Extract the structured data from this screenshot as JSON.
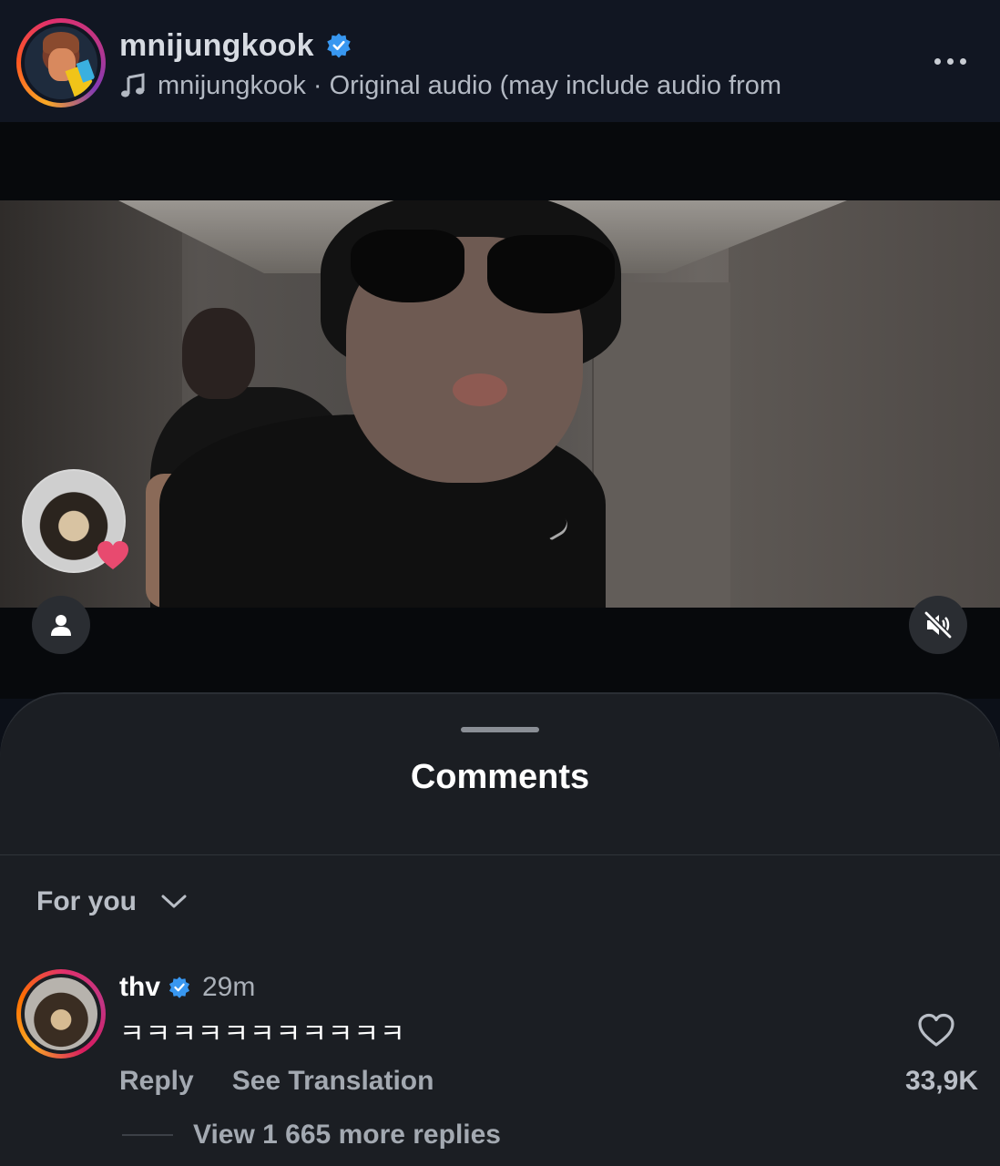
{
  "header": {
    "username": "mnijungkook",
    "audio_text": "mnijungkook · Original audio  (may include audio from",
    "verified_icon": "verified-badge-icon",
    "more_icon": "more-options-icon"
  },
  "video": {
    "tag_icon": "tagged-people-icon",
    "mute_icon": "muted-speaker-icon"
  },
  "comments_sheet": {
    "title": "Comments",
    "filter_label": "For you",
    "comment": {
      "username": "thv",
      "time": "29m",
      "text": "ㅋㅋㅋㅋㅋㅋㅋㅋㅋㅋㅋ",
      "reply_label": "Reply",
      "translate_label": "See Translation",
      "like_count": "33,9K",
      "view_replies": "View 1 665 more replies"
    }
  },
  "colors": {
    "background": "#0c1018",
    "sheet": "#1b1e23",
    "verified": "#3897f0",
    "liker_heart": "#e84a6f"
  }
}
